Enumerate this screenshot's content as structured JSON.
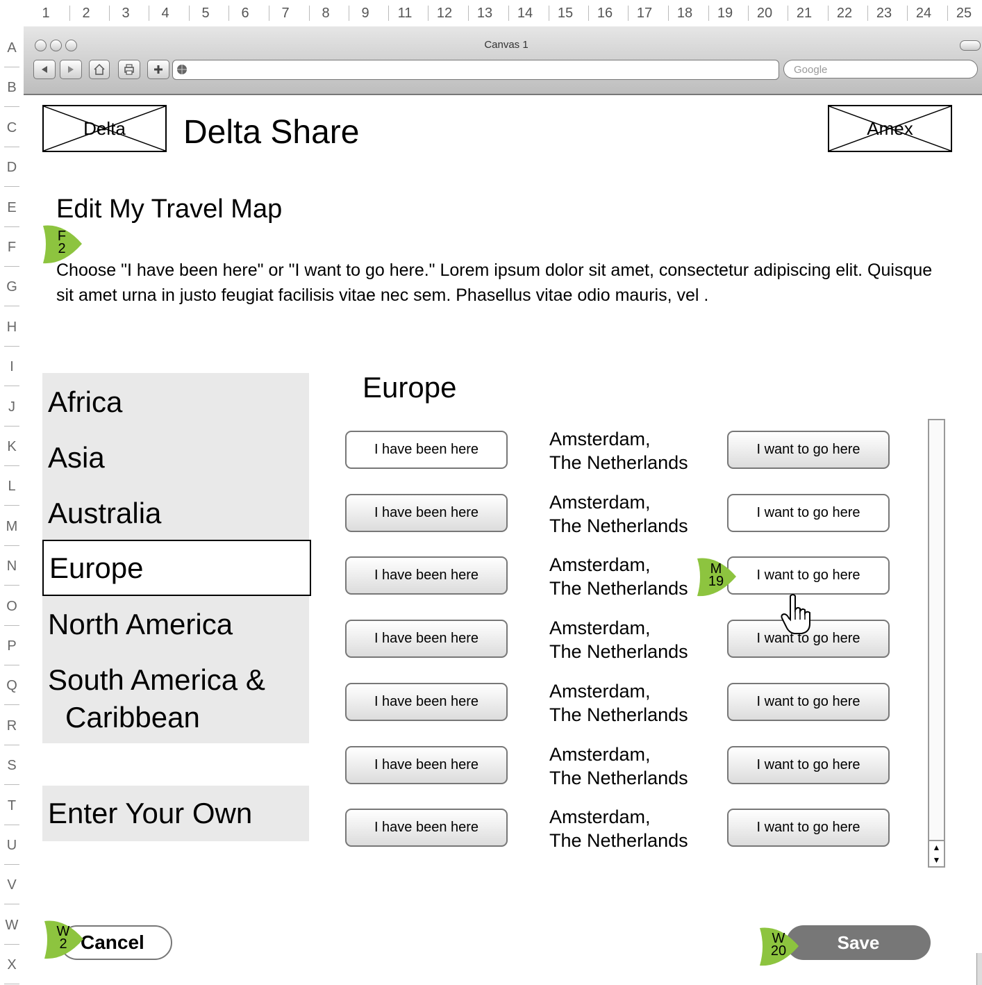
{
  "ruler": {
    "columns": [
      "1",
      "2",
      "3",
      "4",
      "5",
      "6",
      "7",
      "8",
      "9",
      "11",
      "12",
      "13",
      "14",
      "15",
      "16",
      "17",
      "18",
      "19",
      "20",
      "21",
      "22",
      "23",
      "24",
      "25"
    ],
    "rows": [
      "A",
      "B",
      "C",
      "D",
      "E",
      "F",
      "G",
      "H",
      "I",
      "J",
      "K",
      "L",
      "M",
      "N",
      "O",
      "P",
      "Q",
      "R",
      "S",
      "T",
      "U",
      "V",
      "W",
      "X"
    ]
  },
  "browser": {
    "window_title": "Canvas 1",
    "search_placeholder": "Google",
    "back_icon": "back-arrow-icon",
    "forward_icon": "forward-arrow-icon",
    "home_icon": "home-icon",
    "print_icon": "print-icon",
    "add_icon": "plus-icon"
  },
  "header": {
    "left_logo": "Delta",
    "site_title": "Delta Share",
    "right_logo": "Amex"
  },
  "page": {
    "title": "Edit My Travel Map",
    "intro": "Choose \"I have been here\" or \"I want to go here.\" Lorem ipsum dolor sit amet, consectetur adipiscing elit. Quisque sit amet urna in justo feugiat facilisis vitae nec sem. Phasellus vitae odio mauris, vel ."
  },
  "regions": {
    "items": [
      "Africa",
      "Asia",
      "Australia",
      "Europe",
      "North America",
      "South America &",
      "Caribbean"
    ],
    "selected": "Europe",
    "enter_own": "Enter Your Own"
  },
  "destinations": {
    "heading": "Europe",
    "been_label": "I have been here",
    "want_label": "I want to go here",
    "rows": [
      {
        "city": "Amsterdam,",
        "country": "The Netherlands"
      },
      {
        "city": "Amsterdam,",
        "country": "The Netherlands"
      },
      {
        "city": "Amsterdam,",
        "country": "The Netherlands"
      },
      {
        "city": "Amsterdam,",
        "country": "The Netherlands"
      },
      {
        "city": "Amsterdam,",
        "country": "The Netherlands"
      },
      {
        "city": "Amsterdam,",
        "country": "The Netherlands"
      },
      {
        "city": "Amsterdam,",
        "country": "The Netherlands"
      }
    ]
  },
  "footer": {
    "cancel": "Cancel",
    "save": "Save"
  },
  "markers": {
    "f2": {
      "letter": "F",
      "num": "2"
    },
    "m19": {
      "letter": "M",
      "num": "19"
    },
    "w2": {
      "letter": "W",
      "num": "2"
    },
    "w20": {
      "letter": "W",
      "num": "20"
    }
  },
  "colors": {
    "marker_green": "#8dc43f",
    "panel_gray": "#e9e9e9",
    "save_gray": "#777777"
  }
}
